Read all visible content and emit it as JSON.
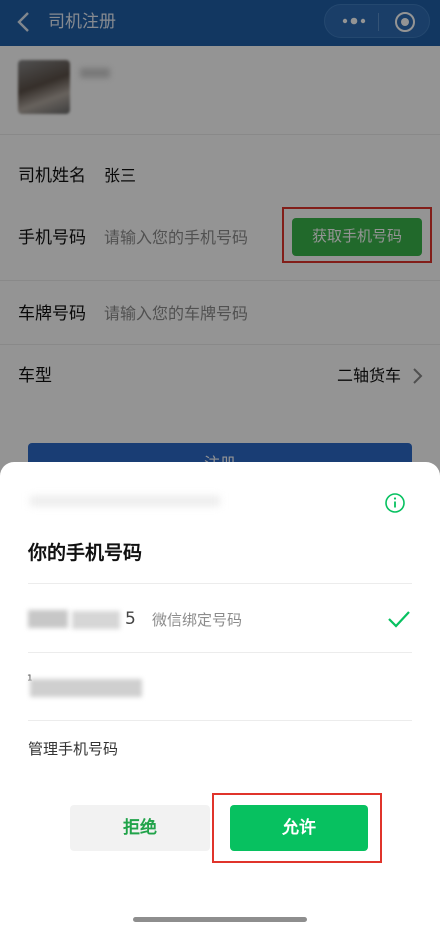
{
  "nav": {
    "title": "司机注册",
    "back_icon": "chevron-left-icon",
    "more_icon": "more-dots-icon",
    "close_icon": "target-close-icon"
  },
  "form": {
    "name_label": "司机姓名",
    "name_value": "张三",
    "phone_label": "手机号码",
    "phone_placeholder": "请输入您的手机号码",
    "get_phone_button": "获取手机号码",
    "plate_label": "车牌号码",
    "plate_placeholder": "请输入您的车牌号码",
    "car_type_label": "车型",
    "car_type_value": "二轴货车",
    "register_button": "注册"
  },
  "sheet": {
    "title": "你的手机号码",
    "phone1_visible_tail": "5",
    "phone1_note": "微信绑定号码",
    "phone2_visible_head": "¹",
    "manage_link": "管理手机号码",
    "reject_button": "拒绝",
    "allow_button": "允许"
  },
  "colors": {
    "nav_bg": "#1f5fa8",
    "accent_green": "#07c160",
    "highlight_red": "#e0342b",
    "register_blue": "#2b69c8"
  }
}
